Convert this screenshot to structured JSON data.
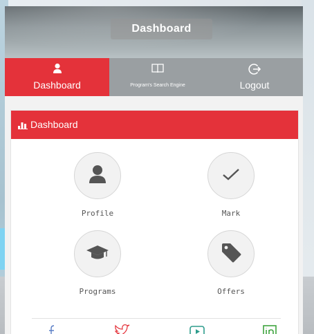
{
  "header": {
    "title": "Dashboard"
  },
  "tabs": [
    {
      "label": "Dashboard",
      "icon": "user-icon",
      "active": true
    },
    {
      "label": "Program's Search Engine",
      "icon": "book-icon",
      "active": false
    },
    {
      "label": "Logout",
      "icon": "logout-icon",
      "active": false
    }
  ],
  "card": {
    "title": "Dashboard",
    "icon": "bar-chart-icon"
  },
  "features": [
    {
      "label": "Profile",
      "icon": "user-icon"
    },
    {
      "label": "Mark",
      "icon": "check-icon"
    },
    {
      "label": "Programs",
      "icon": "graduation-cap-icon"
    },
    {
      "label": "Offers",
      "icon": "tag-icon"
    }
  ],
  "social": [
    "facebook-icon",
    "twitter-icon",
    "youtube-icon",
    "linkedin-icon"
  ],
  "colors": {
    "accent": "#e4323a",
    "tab_bar": "#9a9fa2",
    "icon_gray": "#555555"
  }
}
